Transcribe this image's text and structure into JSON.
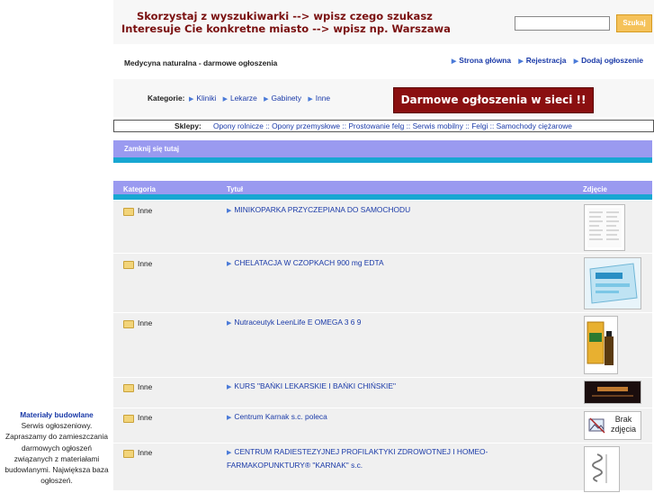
{
  "banner": {
    "line1": "Skorzystaj z wyszukiwarki --> wpisz czego szukasz",
    "line2": "Interesuje Cie konkretne miasto --> wpisz np. Warszawa",
    "search_button": "Szukaj"
  },
  "site_title": "Medycyna naturalna - darmowe ogłoszenia",
  "nav": [
    "Strona główna",
    "Rejestracja",
    "Dodaj ogłoszenie"
  ],
  "categories": {
    "label": "Kategorie:",
    "items": [
      "Kliniki",
      "Lekarze",
      "Gabinety",
      "Inne"
    ]
  },
  "ad_banner": "Darmowe ogłoszenia w sieci !!",
  "shops": {
    "label": "Sklepy:",
    "text": "Opony rolnicze :: Opony przemysłowe :: Prostowanie felg :: Serwis mobilny :: Felgi :: Samochody ciężarowe"
  },
  "section_title": "Zamknij się tutaj",
  "table": {
    "headers": {
      "category": "Kategoria",
      "title": "Tytuł",
      "photo": "Zdjęcie"
    },
    "rows": [
      {
        "category": "Inne",
        "title": "MINIKOPARKA PRZYCZEPIANA DO SAMOCHODU"
      },
      {
        "category": "Inne",
        "title": "CHELATACJA W CZOPKACH 900 mg EDTA"
      },
      {
        "category": "Inne",
        "title": "Nutraceutyk LeenLife E OMEGA 3 6 9"
      },
      {
        "category": "Inne",
        "title": "KURS \"BAŃKI LEKARSKIE I BAŃKI CHIŃSKIE\""
      },
      {
        "category": "Inne",
        "title": "Centrum Karnak s.c. poleca"
      },
      {
        "category": "Inne",
        "title": "CENTRUM RADIESTEZYJNEJ PROFILAKTYKI ZDROWOTNEJ I HOMEO-FARMAKOPUNKTURY® \"KARNAK\" s.c."
      }
    ],
    "no_photo": "Brak zdjęcia"
  },
  "sidebar": {
    "title": "Materiały budowlane",
    "text": "Serwis ogłoszeniowy. Zapraszamy do zamieszczania darmowych ogłoszeń związanych z materiałami budowlanymi. Największa baza ogłoszeń."
  }
}
